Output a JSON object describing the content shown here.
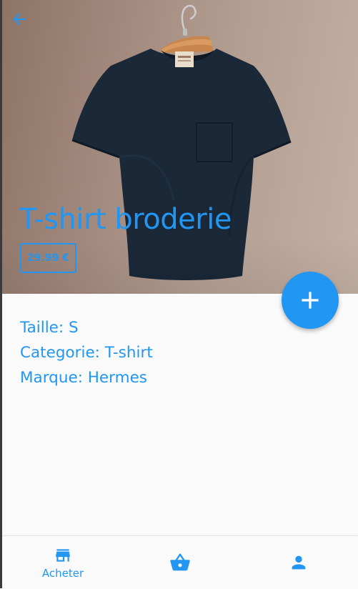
{
  "product": {
    "title": "T-shirt broderie",
    "price": "29.99 €",
    "image_icon": "tshirt-on-hanger-image"
  },
  "details": [
    "Taille: S",
    "Categorie: T-shirt",
    "Marque: Hermes"
  ],
  "header": {
    "back_icon": "arrow-left-icon"
  },
  "fab": {
    "icon": "plus-icon"
  },
  "bottom_nav": {
    "items": [
      {
        "label": "Acheter",
        "icon": "store-icon",
        "active": true
      },
      {
        "label": "",
        "icon": "basket-icon",
        "active": false
      },
      {
        "label": "",
        "icon": "person-icon",
        "active": false
      }
    ]
  },
  "colors": {
    "accent": "#2196f3",
    "background": "#fafafa",
    "shirt": "#1a2838"
  }
}
